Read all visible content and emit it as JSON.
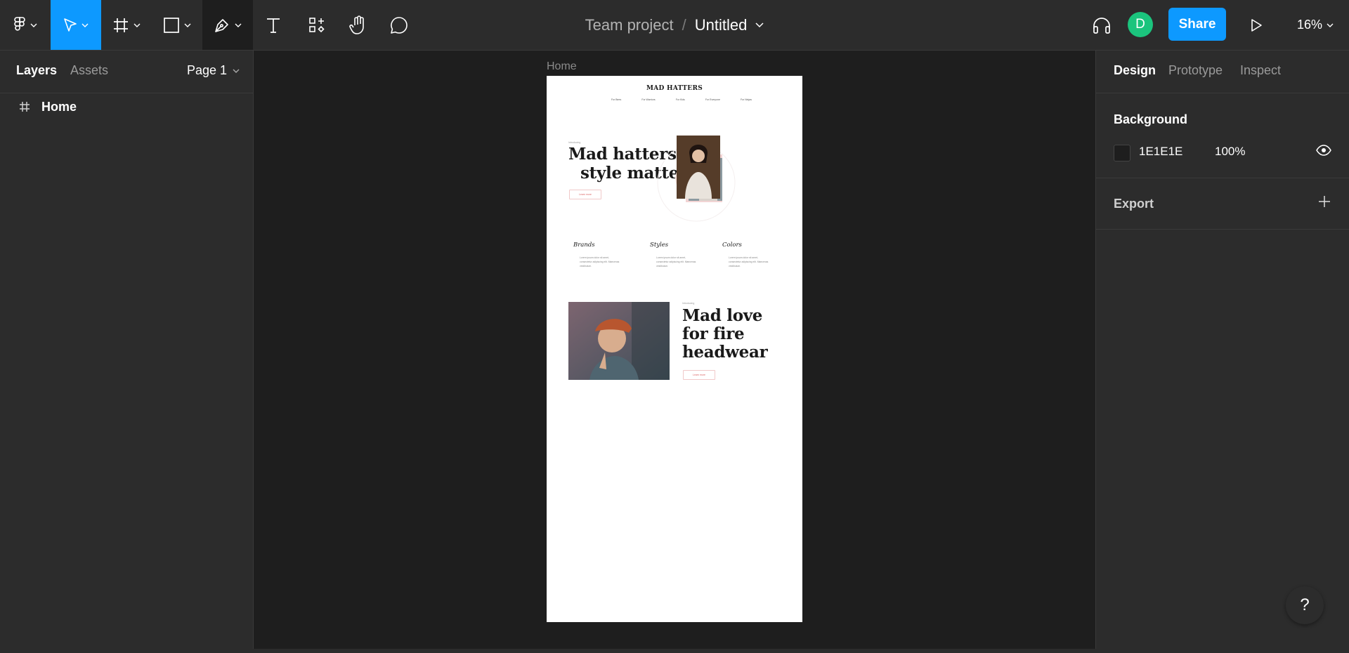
{
  "toolbar": {
    "tools": [
      {
        "name": "main-menu",
        "icon": "figma-logo-icon"
      },
      {
        "name": "move-tool",
        "icon": "cursor-icon",
        "active": true
      },
      {
        "name": "frame-tool",
        "icon": "frame-hash-icon"
      },
      {
        "name": "shape-tool",
        "icon": "rectangle-icon"
      },
      {
        "name": "pen-tool",
        "icon": "pen-nib-icon"
      },
      {
        "name": "text-tool",
        "icon": "text-t-icon"
      },
      {
        "name": "resources-tool",
        "icon": "components-icon"
      },
      {
        "name": "hand-tool",
        "icon": "hand-icon"
      },
      {
        "name": "comment-tool",
        "icon": "speech-bubble-icon"
      }
    ],
    "team": "Team project",
    "separator": "/",
    "file_name": "Untitled",
    "avatar_initial": "D",
    "share_label": "Share",
    "zoom": "16%",
    "accent_color": "#0d99ff"
  },
  "left_panel": {
    "tabs": [
      "Layers",
      "Assets"
    ],
    "page": "Page 1",
    "layers": [
      {
        "name": "Home",
        "type": "frame"
      }
    ]
  },
  "right_panel": {
    "tabs": [
      "Design",
      "Prototype",
      "Inspect"
    ],
    "background": {
      "title": "Background",
      "hex": "1E1E1E",
      "opacity": "100%"
    },
    "export": {
      "title": "Export"
    }
  },
  "canvas": {
    "frame_label": "Home",
    "design": {
      "logo": "MAD HATTERS",
      "nav": [
        "For Bees",
        "For Warriors",
        "For Kids",
        "For Everyone",
        "For Ninjas"
      ],
      "hero_kicker": "Introducing",
      "hero_line1": "Mad hatters,",
      "hero_line2": "style matters",
      "hero_button": "Learn more",
      "columns": [
        {
          "title": "Brands",
          "text": "Lorem ipsum dolor sit amet, consectetur adipiscing elit. Maecenas vestibulum."
        },
        {
          "title": "Styles",
          "text": "Lorem ipsum dolor sit amet, consectetur adipiscing elit. Maecenas vestibulum."
        },
        {
          "title": "Colors",
          "text": "Lorem ipsum dolor sit amet, consectetur adipiscing elit. Maecenas vestibulum."
        }
      ],
      "feature_kicker": "Introducing",
      "feature_line1": "Mad love",
      "feature_line2": "for fire",
      "feature_line3": "headwear",
      "feature_button": "Learn more"
    }
  },
  "help_label": "?"
}
